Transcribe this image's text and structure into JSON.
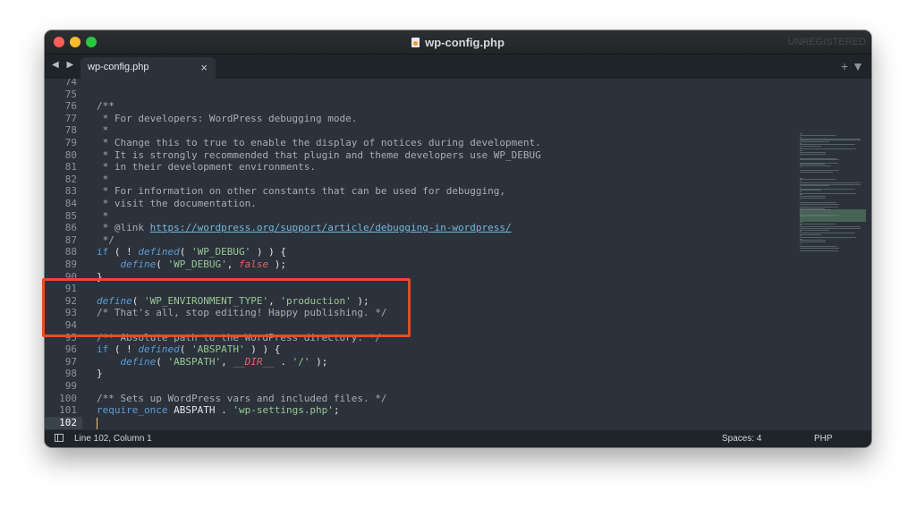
{
  "window": {
    "title": "wp-config.php",
    "license": "UNREGISTERED"
  },
  "tabs": [
    {
      "label": "wp-config.php",
      "close": "×"
    }
  ],
  "tabbar": {
    "nav": "◀ ▶",
    "actions": "+ ▼"
  },
  "editor": {
    "lines": [
      {
        "n": "74",
        "tokens": []
      },
      {
        "n": "75",
        "tokens": []
      },
      {
        "n": "76",
        "tokens": [
          [
            "comment",
            "/**"
          ]
        ]
      },
      {
        "n": "77",
        "tokens": [
          [
            "comment",
            " * For developers: WordPress debugging mode."
          ]
        ]
      },
      {
        "n": "78",
        "tokens": [
          [
            "comment",
            " *"
          ]
        ]
      },
      {
        "n": "79",
        "tokens": [
          [
            "comment",
            " * Change this to true to enable the display of notices during development."
          ]
        ]
      },
      {
        "n": "80",
        "tokens": [
          [
            "comment",
            " * It is strongly recommended that plugin and theme developers use WP_DEBUG"
          ]
        ]
      },
      {
        "n": "81",
        "tokens": [
          [
            "comment",
            " * in their development environments."
          ]
        ]
      },
      {
        "n": "82",
        "tokens": [
          [
            "comment",
            " *"
          ]
        ]
      },
      {
        "n": "83",
        "tokens": [
          [
            "comment",
            " * For information on other constants that can be used for debugging,"
          ]
        ]
      },
      {
        "n": "84",
        "tokens": [
          [
            "comment",
            " * visit the documentation."
          ]
        ]
      },
      {
        "n": "85",
        "tokens": [
          [
            "comment",
            " *"
          ]
        ]
      },
      {
        "n": "86",
        "tokens": [
          [
            "comment",
            " * @link "
          ],
          [
            "link",
            "https://wordpress.org/support/article/debugging-in-wordpress/"
          ]
        ]
      },
      {
        "n": "87",
        "tokens": [
          [
            "comment",
            " */"
          ]
        ]
      },
      {
        "n": "88",
        "tokens": [
          [
            "kw",
            "if"
          ],
          [
            "op",
            " ( ! "
          ],
          [
            "fn",
            "defined"
          ],
          [
            "op",
            "( "
          ],
          [
            "str",
            "'WP_DEBUG'"
          ],
          [
            "op",
            " ) ) {"
          ]
        ]
      },
      {
        "n": "89",
        "tokens": [
          [
            "op",
            "    "
          ],
          [
            "fn",
            "define"
          ],
          [
            "op",
            "( "
          ],
          [
            "str",
            "'WP_DEBUG'"
          ],
          [
            "op",
            ", "
          ],
          [
            "const",
            "false"
          ],
          [
            "op",
            " );"
          ]
        ]
      },
      {
        "n": "90",
        "tokens": [
          [
            "op",
            "}"
          ]
        ]
      },
      {
        "n": "91",
        "tokens": []
      },
      {
        "n": "92",
        "tokens": [
          [
            "fn",
            "define"
          ],
          [
            "op",
            "( "
          ],
          [
            "str",
            "'WP_ENVIRONMENT_TYPE'"
          ],
          [
            "op",
            ", "
          ],
          [
            "str",
            "'production'"
          ],
          [
            "op",
            " );"
          ]
        ]
      },
      {
        "n": "93",
        "tokens": [
          [
            "comment",
            "/* That's all, stop editing! Happy publishing. */"
          ]
        ]
      },
      {
        "n": "94",
        "tokens": []
      },
      {
        "n": "95",
        "tokens": [
          [
            "comment",
            "/** Absolute path to the WordPress directory. */"
          ]
        ]
      },
      {
        "n": "96",
        "tokens": [
          [
            "kw",
            "if"
          ],
          [
            "op",
            " ( ! "
          ],
          [
            "fn",
            "defined"
          ],
          [
            "op",
            "( "
          ],
          [
            "str",
            "'ABSPATH'"
          ],
          [
            "op",
            " ) ) {"
          ]
        ]
      },
      {
        "n": "97",
        "tokens": [
          [
            "op",
            "    "
          ],
          [
            "fn",
            "define"
          ],
          [
            "op",
            "( "
          ],
          [
            "str",
            "'ABSPATH'"
          ],
          [
            "op",
            ", "
          ],
          [
            "const",
            "__DIR__"
          ],
          [
            "op",
            " . "
          ],
          [
            "str",
            "'/'"
          ],
          [
            "op",
            " );"
          ]
        ]
      },
      {
        "n": "98",
        "tokens": [
          [
            "op",
            "}"
          ]
        ]
      },
      {
        "n": "99",
        "tokens": []
      },
      {
        "n": "100",
        "tokens": [
          [
            "comment",
            "/** Sets up WordPress vars and included files. */"
          ]
        ]
      },
      {
        "n": "101",
        "tokens": [
          [
            "kw",
            "require_once"
          ],
          [
            "op",
            " ABSPATH . "
          ],
          [
            "str",
            "'wp-settings.php'"
          ],
          [
            "op",
            ";"
          ]
        ]
      },
      {
        "n": "102",
        "tokens": [],
        "current": true
      }
    ]
  },
  "status": {
    "position": "Line 102, Column 1",
    "spaces": "Spaces: 4",
    "syntax": "PHP"
  },
  "colors": {
    "highlight_box": "#e84b2b",
    "background": "#2b323b"
  }
}
